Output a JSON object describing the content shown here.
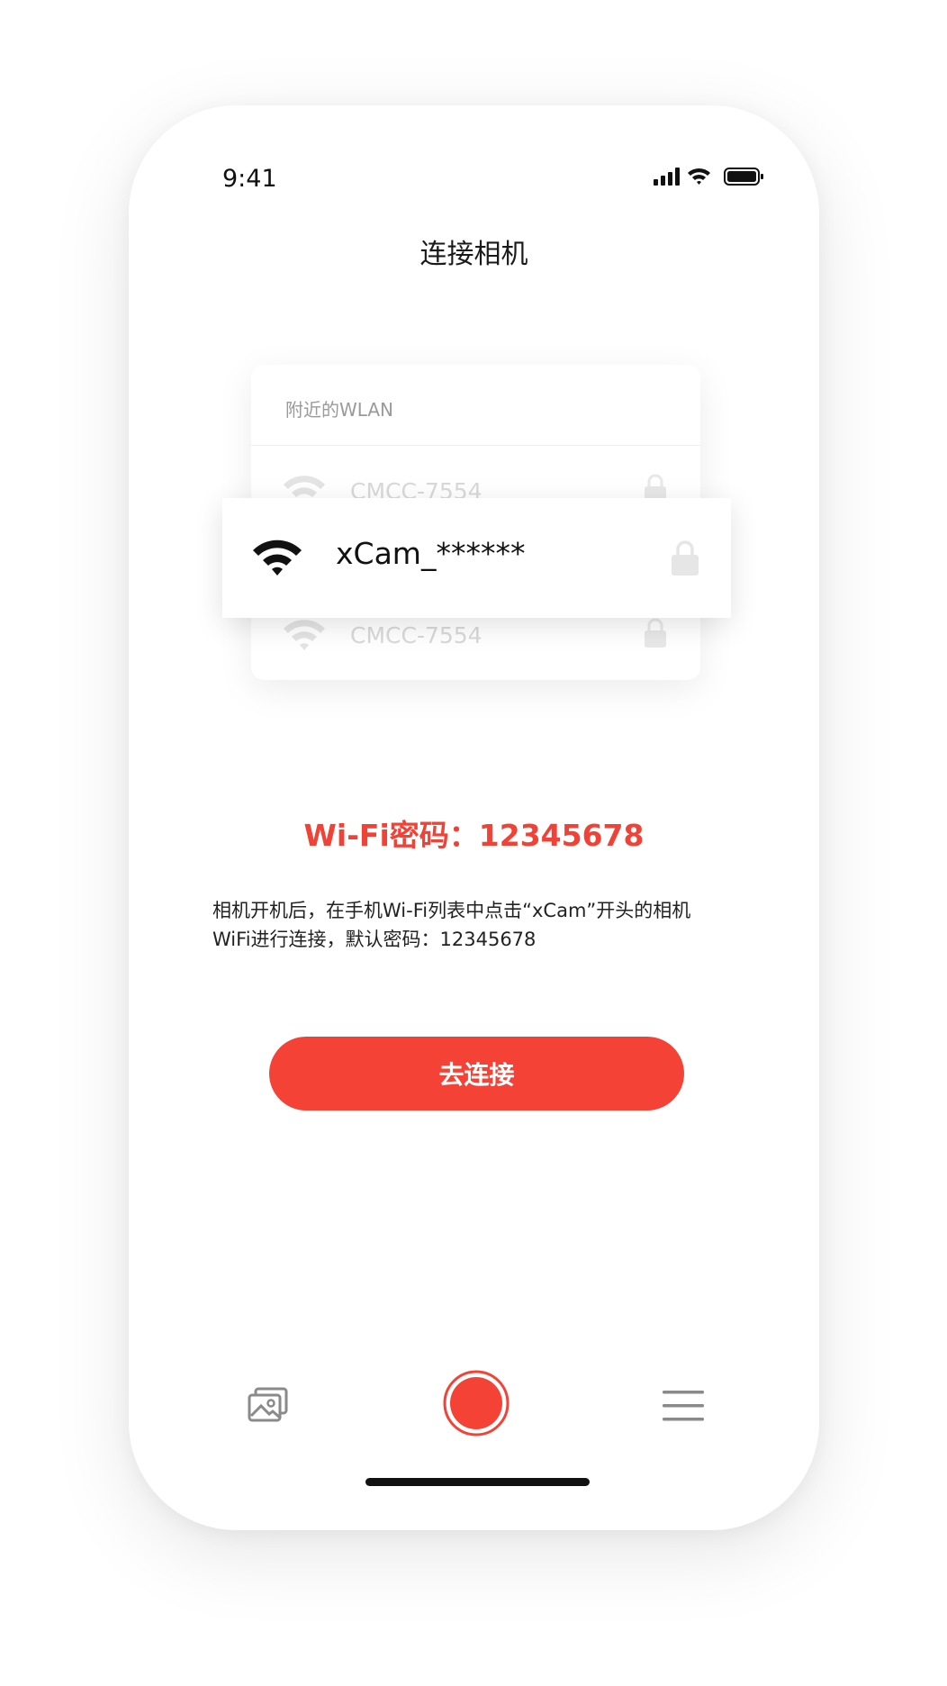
{
  "status_bar": {
    "time": "9:41"
  },
  "header": {
    "title": "连接相机"
  },
  "wlan_card": {
    "heading": "附近的WLAN",
    "ghost_networks": [
      "CMCC-7554",
      "CMCC-7554"
    ],
    "selected_network": "xCam_******"
  },
  "password_line": "Wi-Fi密码：12345678",
  "instructions": {
    "line1": "相机开机后，在手机Wi-Fi列表中点击“xCam”开头的相机",
    "line2": "WiFi进行连接，默认密码：12345678"
  },
  "connect_button": {
    "label": "去连接"
  },
  "tab_bar": {
    "icons": [
      "gallery-icon",
      "record-icon",
      "menu-icon"
    ]
  },
  "colors": {
    "accent": "#f44336",
    "ghost_text": "#d9d9d9"
  }
}
